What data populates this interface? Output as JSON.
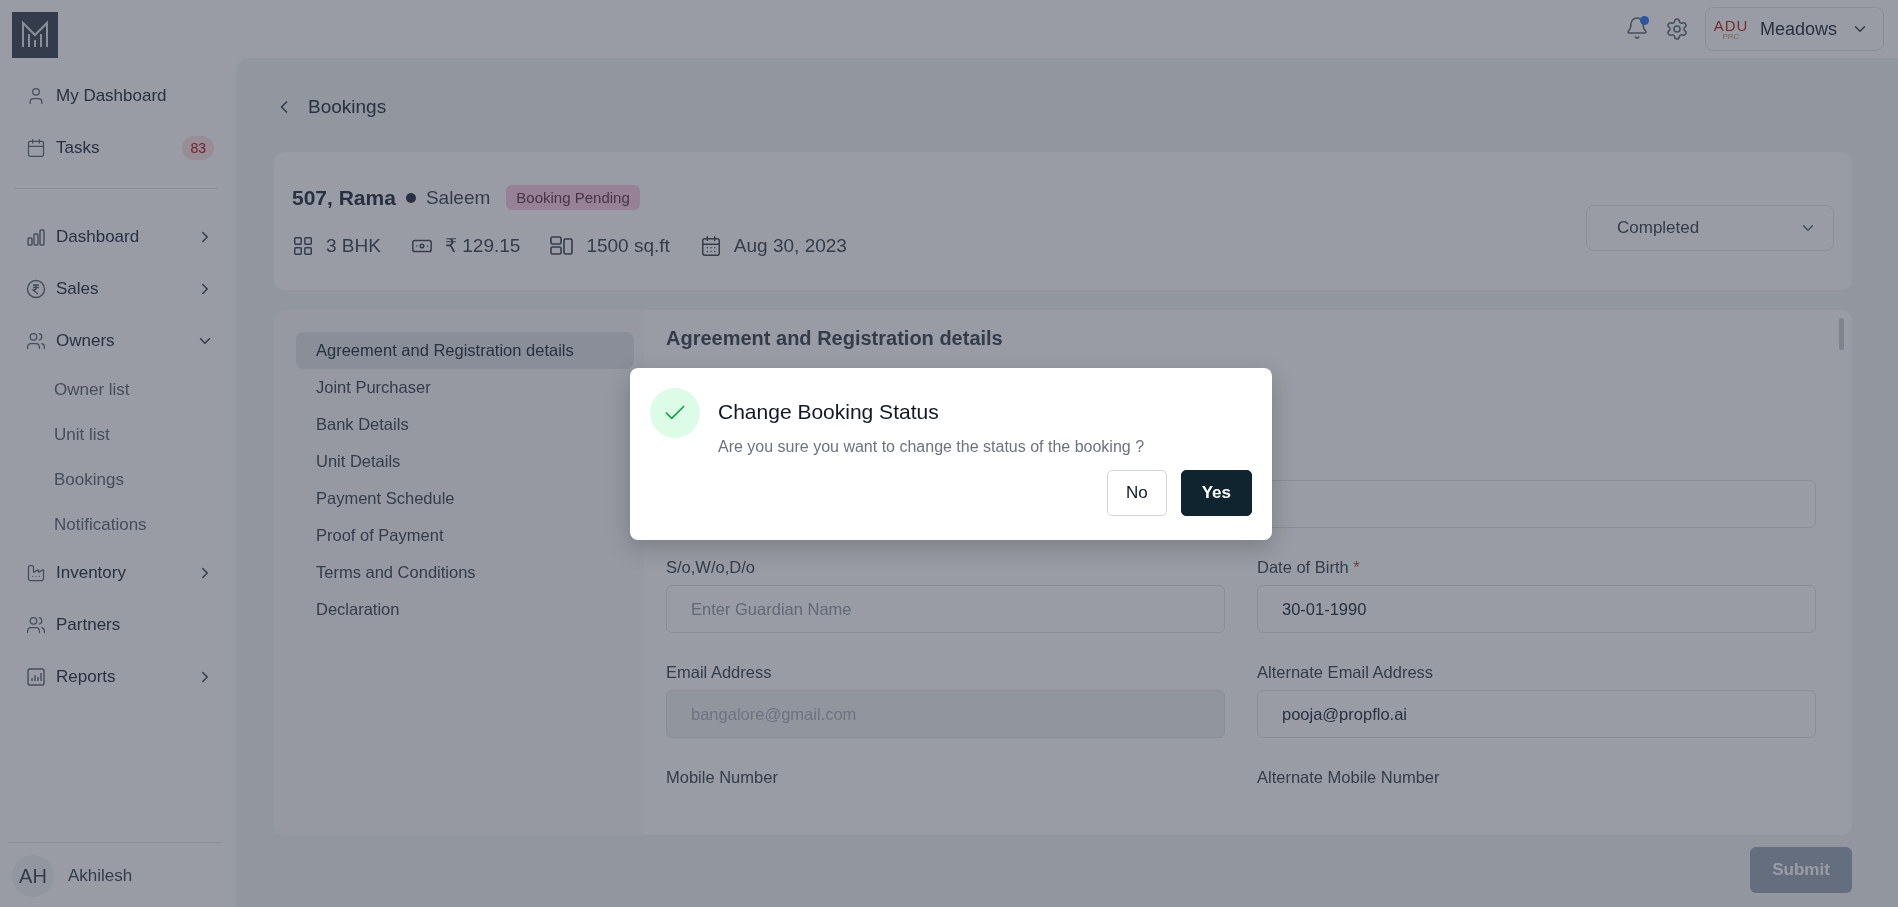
{
  "topbar": {
    "notifications": {
      "unread": true
    },
    "org": {
      "logo_text": "ADU",
      "logo_subtext": "PRC",
      "name": "Meadows"
    }
  },
  "sidebar": {
    "top_items": [
      {
        "label": "My Dashboard"
      },
      {
        "label": "Tasks",
        "badge": "83"
      }
    ],
    "items": [
      {
        "label": "Dashboard",
        "expanded": false
      },
      {
        "label": "Sales",
        "expanded": false
      },
      {
        "label": "Owners",
        "expanded": true,
        "children": [
          {
            "label": "Owner list"
          },
          {
            "label": "Unit list"
          },
          {
            "label": "Bookings"
          },
          {
            "label": "Notifications"
          }
        ]
      },
      {
        "label": "Inventory",
        "expanded": false
      },
      {
        "label": "Partners"
      },
      {
        "label": "Reports",
        "expanded": false
      }
    ],
    "user": {
      "initials": "AH",
      "name": "Akhilesh"
    }
  },
  "breadcrumb": {
    "label": "Bookings"
  },
  "booking": {
    "title": "507, Rama",
    "owner": "Saleem",
    "status": "Booking Pending",
    "facts": [
      "3 BHK",
      "₹ 129.15",
      "1500 sq.ft",
      "Aug 30, 2023"
    ],
    "status_select": {
      "value": "Completed"
    }
  },
  "sections": [
    {
      "label": "Agreement and Registration details",
      "selected": true
    },
    {
      "label": "Joint Purchaser",
      "selected": false
    },
    {
      "label": "Bank Details",
      "selected": false
    },
    {
      "label": "Unit Details",
      "selected": false
    },
    {
      "label": "Payment Schedule",
      "selected": false
    },
    {
      "label": "Proof of Payment",
      "selected": false
    },
    {
      "label": "Terms and Conditions",
      "selected": false
    },
    {
      "label": "Declaration",
      "selected": false
    }
  ],
  "form": {
    "title": "Agreement and Registration details",
    "fields": [
      {
        "kind": "input"
      },
      {
        "kind": "input",
        "label": "S/o,W/o,D/o",
        "placeholder": "Enter Guardian Name"
      },
      {
        "kind": "input",
        "label": "Date of Birth",
        "value": "30-01-1990",
        "required_mark": "*"
      },
      {
        "kind": "input",
        "label": "Email Address",
        "value": "bangalore@gmail.com",
        "disabled": true
      },
      {
        "kind": "input",
        "label": "Alternate Email Address",
        "value": "pooja@propflo.ai"
      },
      {
        "kind": "label",
        "label": "Mobile Number"
      },
      {
        "kind": "label",
        "label": "Alternate Mobile Number"
      }
    ]
  },
  "submit": {
    "label": "Submit"
  },
  "modal": {
    "title": "Change Booking Status",
    "message": "Are you sure you want to change the status of the booking ?",
    "buttons": [
      {
        "label": "No",
        "kind": "secondary"
      },
      {
        "label": "Yes",
        "kind": "primary"
      }
    ]
  }
}
